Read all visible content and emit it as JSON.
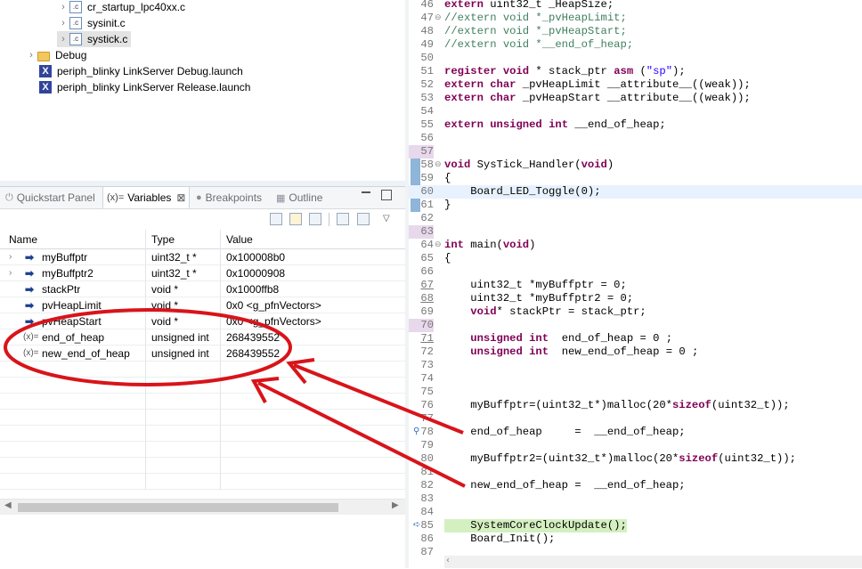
{
  "project_tree": {
    "items": [
      {
        "label": "cr_startup_lpc40xx.c",
        "icon": "c-file-icon",
        "expander": "›"
      },
      {
        "label": "sysinit.c",
        "icon": "c-file-icon",
        "expander": "›"
      },
      {
        "label": "systick.c",
        "icon": "c-file-icon",
        "expander": "›"
      },
      {
        "label": "Debug",
        "icon": "folder-icon",
        "expander": "›"
      },
      {
        "label": "periph_blinky LinkServer Debug.launch",
        "icon": "launch-icon"
      },
      {
        "label": "periph_blinky LinkServer Release.launch",
        "icon": "launch-icon"
      }
    ]
  },
  "tabs": [
    {
      "label": "Quickstart Panel"
    },
    {
      "label": "Variables",
      "prefix": "(x)=",
      "close": "⊠"
    },
    {
      "label": "Breakpoints"
    },
    {
      "label": "Outline"
    }
  ],
  "variables": {
    "headers": {
      "name": "Name",
      "type": "Type",
      "value": "Value"
    },
    "rows": [
      {
        "name": "myBuffptr",
        "type": "uint32_t *",
        "value": "0x100008b0"
      },
      {
        "name": "myBuffptr2",
        "type": "uint32_t *",
        "value": "0x10000908"
      },
      {
        "name": "stackPtr",
        "type": "void *",
        "value": "0x1000ffb8"
      },
      {
        "name": "pvHeapLimit",
        "type": "void *",
        "value": "0x0 <g_pfnVectors>"
      },
      {
        "name": "pvHeapStart",
        "type": "void *",
        "value": "0x0 <g_pfnVectors>"
      },
      {
        "name": "end_of_heap",
        "type": "unsigned int",
        "value": "268439552"
      },
      {
        "name": "new_end_of_heap",
        "type": "unsigned int",
        "value": "268439552"
      }
    ]
  },
  "editor": {
    "lines": [
      {
        "n": "46",
        "code": "extern uint32_t _HeapSize;"
      },
      {
        "n": "47",
        "code": "//extern void *_pvHeapLimit;"
      },
      {
        "n": "48",
        "code": "//extern void *_pvHeapStart;"
      },
      {
        "n": "49",
        "code": "//extern void *__end_of_heap;"
      },
      {
        "n": "50",
        "code": ""
      },
      {
        "n": "51",
        "code": "register void * stack_ptr asm (\"sp\");"
      },
      {
        "n": "52",
        "code": "extern char _pvHeapLimit __attribute__((weak));"
      },
      {
        "n": "53",
        "code": "extern char _pvHeapStart __attribute__((weak));"
      },
      {
        "n": "54",
        "code": ""
      },
      {
        "n": "55",
        "code": "extern unsigned int __end_of_heap;"
      },
      {
        "n": "56",
        "code": ""
      },
      {
        "n": "57",
        "code": ""
      },
      {
        "n": "58",
        "code": "void SysTick_Handler(void)"
      },
      {
        "n": "59",
        "code": "{"
      },
      {
        "n": "60",
        "code": "    Board_LED_Toggle(0);"
      },
      {
        "n": "61",
        "code": "}"
      },
      {
        "n": "62",
        "code": ""
      },
      {
        "n": "63",
        "code": ""
      },
      {
        "n": "64",
        "code": "int main(void)"
      },
      {
        "n": "65",
        "code": "{"
      },
      {
        "n": "66",
        "code": ""
      },
      {
        "n": "67",
        "code": "    uint32_t *myBuffptr = 0;"
      },
      {
        "n": "68",
        "code": "    uint32_t *myBuffptr2 = 0;"
      },
      {
        "n": "69",
        "code": "    void* stackPtr = stack_ptr;"
      },
      {
        "n": "70",
        "code": ""
      },
      {
        "n": "71",
        "code": "    unsigned int  end_of_heap = 0 ;"
      },
      {
        "n": "72",
        "code": "    unsigned int  new_end_of_heap = 0 ;"
      },
      {
        "n": "73",
        "code": ""
      },
      {
        "n": "74",
        "code": ""
      },
      {
        "n": "75",
        "code": ""
      },
      {
        "n": "76",
        "code": "    myBuffptr=(uint32_t*)malloc(20*sizeof(uint32_t));"
      },
      {
        "n": "77",
        "code": ""
      },
      {
        "n": "78",
        "code": "    end_of_heap     =  __end_of_heap;"
      },
      {
        "n": "79",
        "code": ""
      },
      {
        "n": "80",
        "code": "    myBuffptr2=(uint32_t*)malloc(20*sizeof(uint32_t));"
      },
      {
        "n": "81",
        "code": ""
      },
      {
        "n": "82",
        "code": "    new_end_of_heap =  __end_of_heap;"
      },
      {
        "n": "83",
        "code": ""
      },
      {
        "n": "84",
        "code": ""
      },
      {
        "n": "85",
        "code": "    SystemCoreClockUpdate();"
      },
      {
        "n": "86",
        "code": "    Board_Init();"
      },
      {
        "n": "87",
        "code": ""
      }
    ]
  },
  "colors": {
    "keyword": "#7f0055",
    "comment": "#3f7f5f",
    "string": "#2a00ff",
    "annotation": "#d8141a",
    "current_line": "#d4f0c0"
  }
}
